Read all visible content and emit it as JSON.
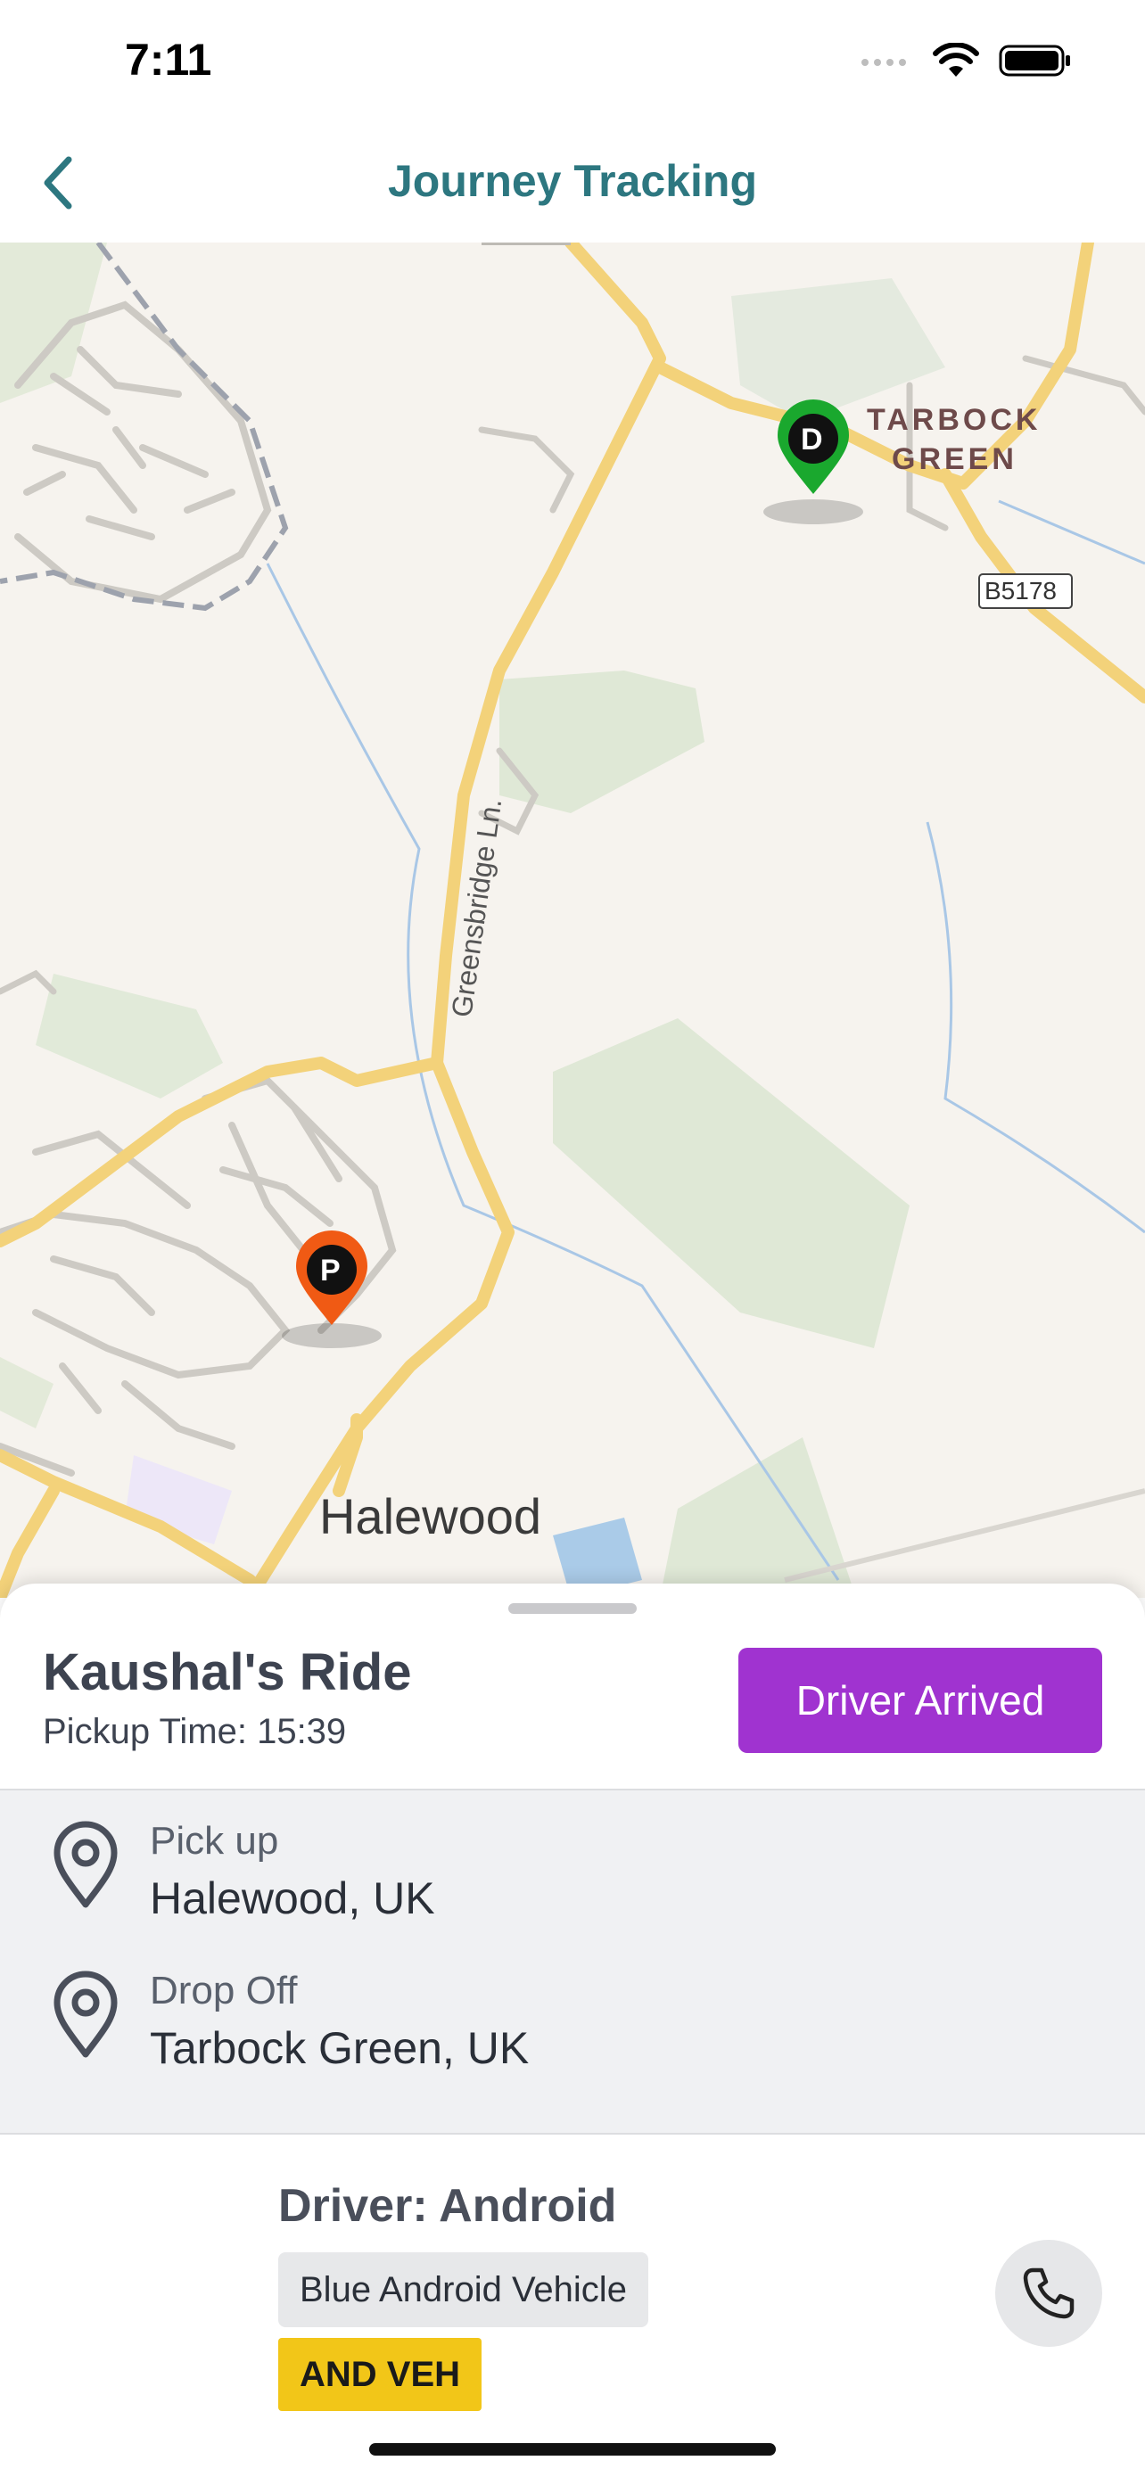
{
  "status_bar": {
    "time": "7:11",
    "icons": [
      "cellular-icon",
      "wifi-icon",
      "battery-icon"
    ]
  },
  "nav": {
    "title": "Journey Tracking",
    "back_icon": "chevron-left-icon"
  },
  "map": {
    "labels": {
      "area_top": "TARBOCK\nGREEN",
      "area_top_line1": "TARBOCK",
      "area_top_line2": "GREEN",
      "road_sign": "B5178",
      "road_name": "Greensbridge Ln.",
      "town": "Halewood"
    },
    "markers": {
      "pickup": "P",
      "dropoff": "D"
    },
    "colors": {
      "pickup": "#f05a14",
      "dropoff": "#1aa82e"
    }
  },
  "ride": {
    "title": "Kaushal's Ride",
    "pickup_time": "Pickup Time: 15:39",
    "status_button": "Driver Arrived",
    "accent": "#a033d0"
  },
  "addresses": {
    "pickup_label": "Pick up",
    "pickup_value": "Halewood, UK",
    "dropoff_label": "Drop Off",
    "dropoff_value": "Tarbock Green, UK"
  },
  "driver": {
    "name": "Driver: Android",
    "vehicle": "Blue Android Vehicle",
    "plate": "AND VEH"
  }
}
